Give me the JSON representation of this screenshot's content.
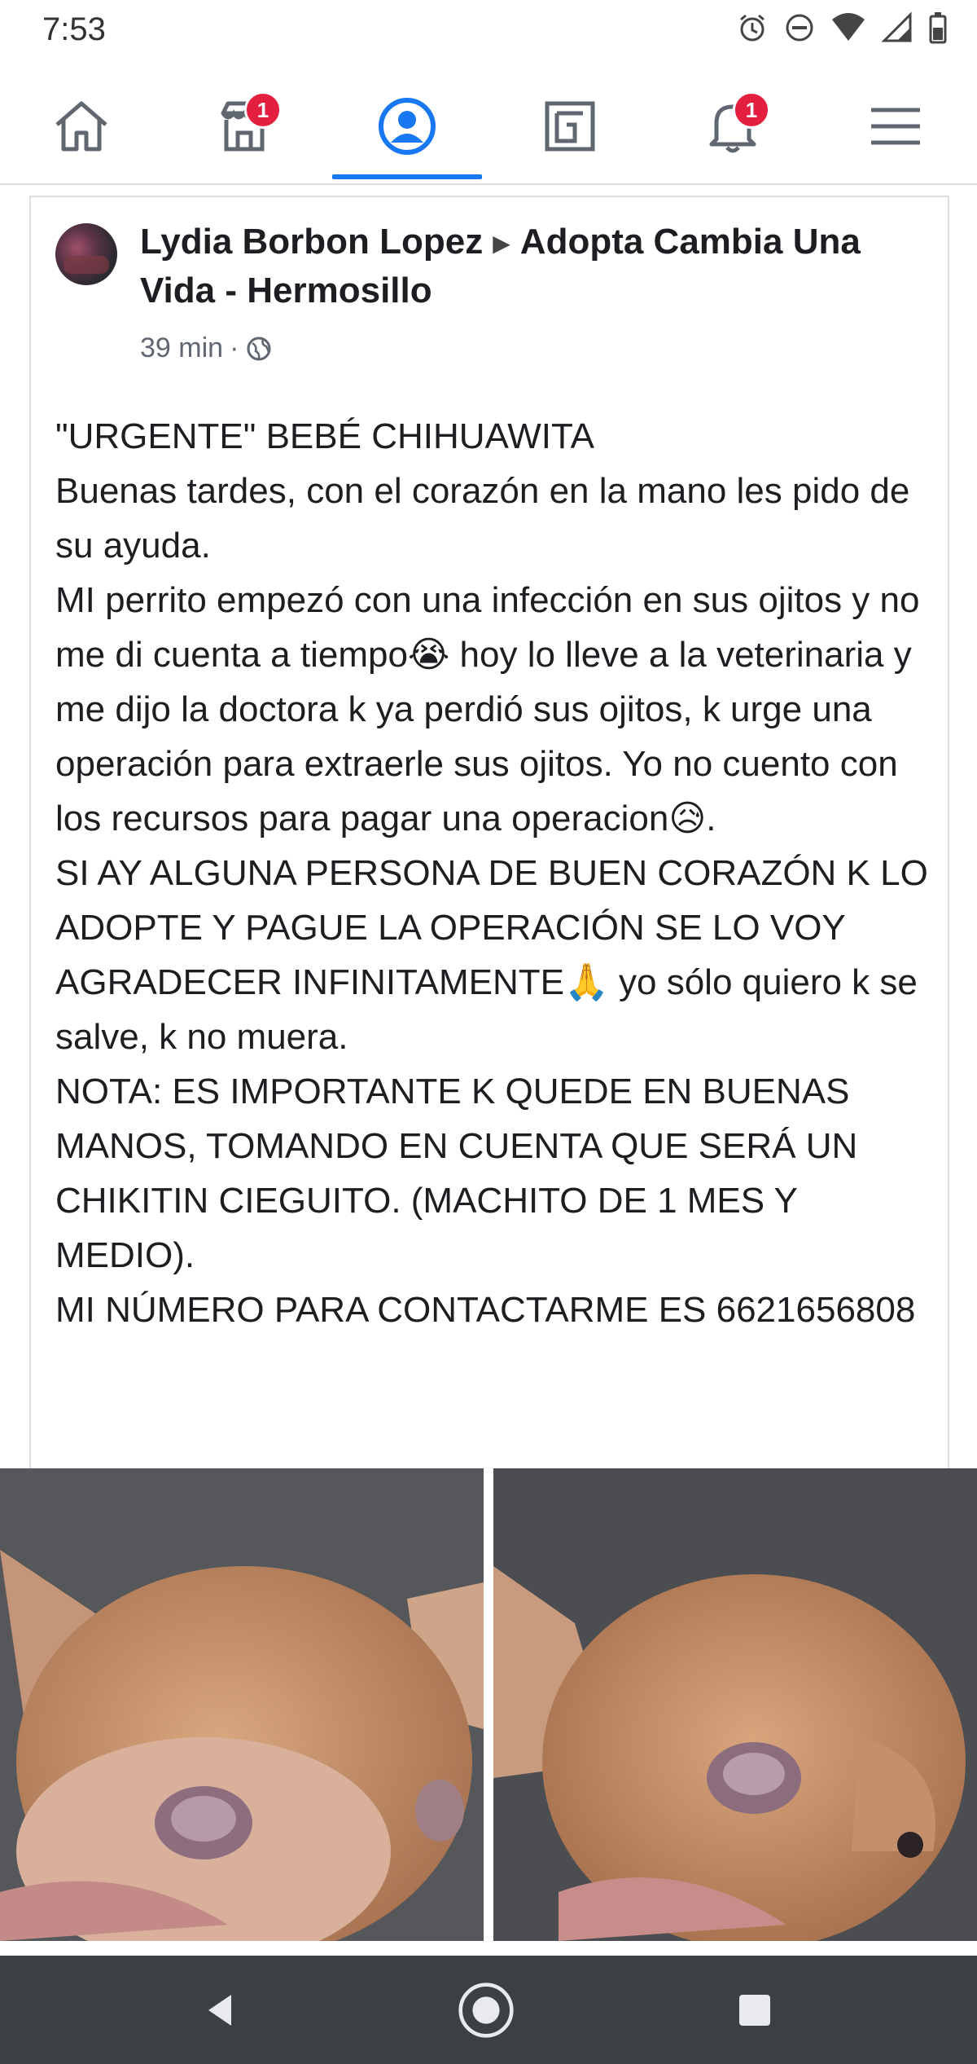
{
  "status_bar": {
    "time": "7:53",
    "icons": [
      "alarm-icon",
      "do-not-disturb-icon",
      "wifi-icon",
      "signal-icon",
      "battery-icon"
    ]
  },
  "nav": {
    "items": [
      {
        "name": "home",
        "icon": "home-icon",
        "badge": ""
      },
      {
        "name": "marketplace",
        "icon": "marketplace-icon",
        "badge": "1"
      },
      {
        "name": "profile",
        "icon": "profile-icon",
        "badge": "",
        "active": true
      },
      {
        "name": "pages",
        "icon": "pages-icon",
        "badge": ""
      },
      {
        "name": "notifications",
        "icon": "bell-icon",
        "badge": "1"
      },
      {
        "name": "menu",
        "icon": "hamburger-icon",
        "badge": ""
      }
    ],
    "active_color": "#1877f2"
  },
  "post": {
    "author": "Lydia Borbon Lopez",
    "group": "Adopta Cambia Una Vida - Hermosillo",
    "time": "39 min",
    "separator": "·",
    "privacy_icon": "globe-icon",
    "text": "\"URGENTE\" BEBÉ CHIHUAWITA\nBuenas tardes, con el corazón en la mano les pido de su ayuda.\nMI perrito empezó con una infección en sus ojitos y no me di cuenta a tiempo😭 hoy lo lleve a la veterinaria y me dijo la doctora k ya perdió sus ojitos, k urge una operación para extraerle sus ojitos. Yo no cuento con los recursos para pagar una operacion😥.\nSI AY ALGUNA PERSONA DE BUEN CORAZÓN K LO ADOPTE Y PAGUE LA OPERACIÓN SE LO VOY AGRADECER INFINITAMENTE🙏 yo sólo quiero k se salve, k no muera.\nNOTA: ES IMPORTANTE K QUEDE EN BUENAS MANOS, TOMANDO EN CUENTA QUE SERÁ UN  CHIKITIN CIEGUITO. (MACHITO DE 1 MES Y MEDIO).\nMI NÚMERO PARA CONTACTARME ES 6621656808"
  },
  "photos": [
    {
      "description_icon": "puppy-photo-1"
    },
    {
      "description_icon": "puppy-photo-2"
    }
  ],
  "system_nav": [
    "back-icon",
    "home-circle-icon",
    "recents-icon"
  ]
}
